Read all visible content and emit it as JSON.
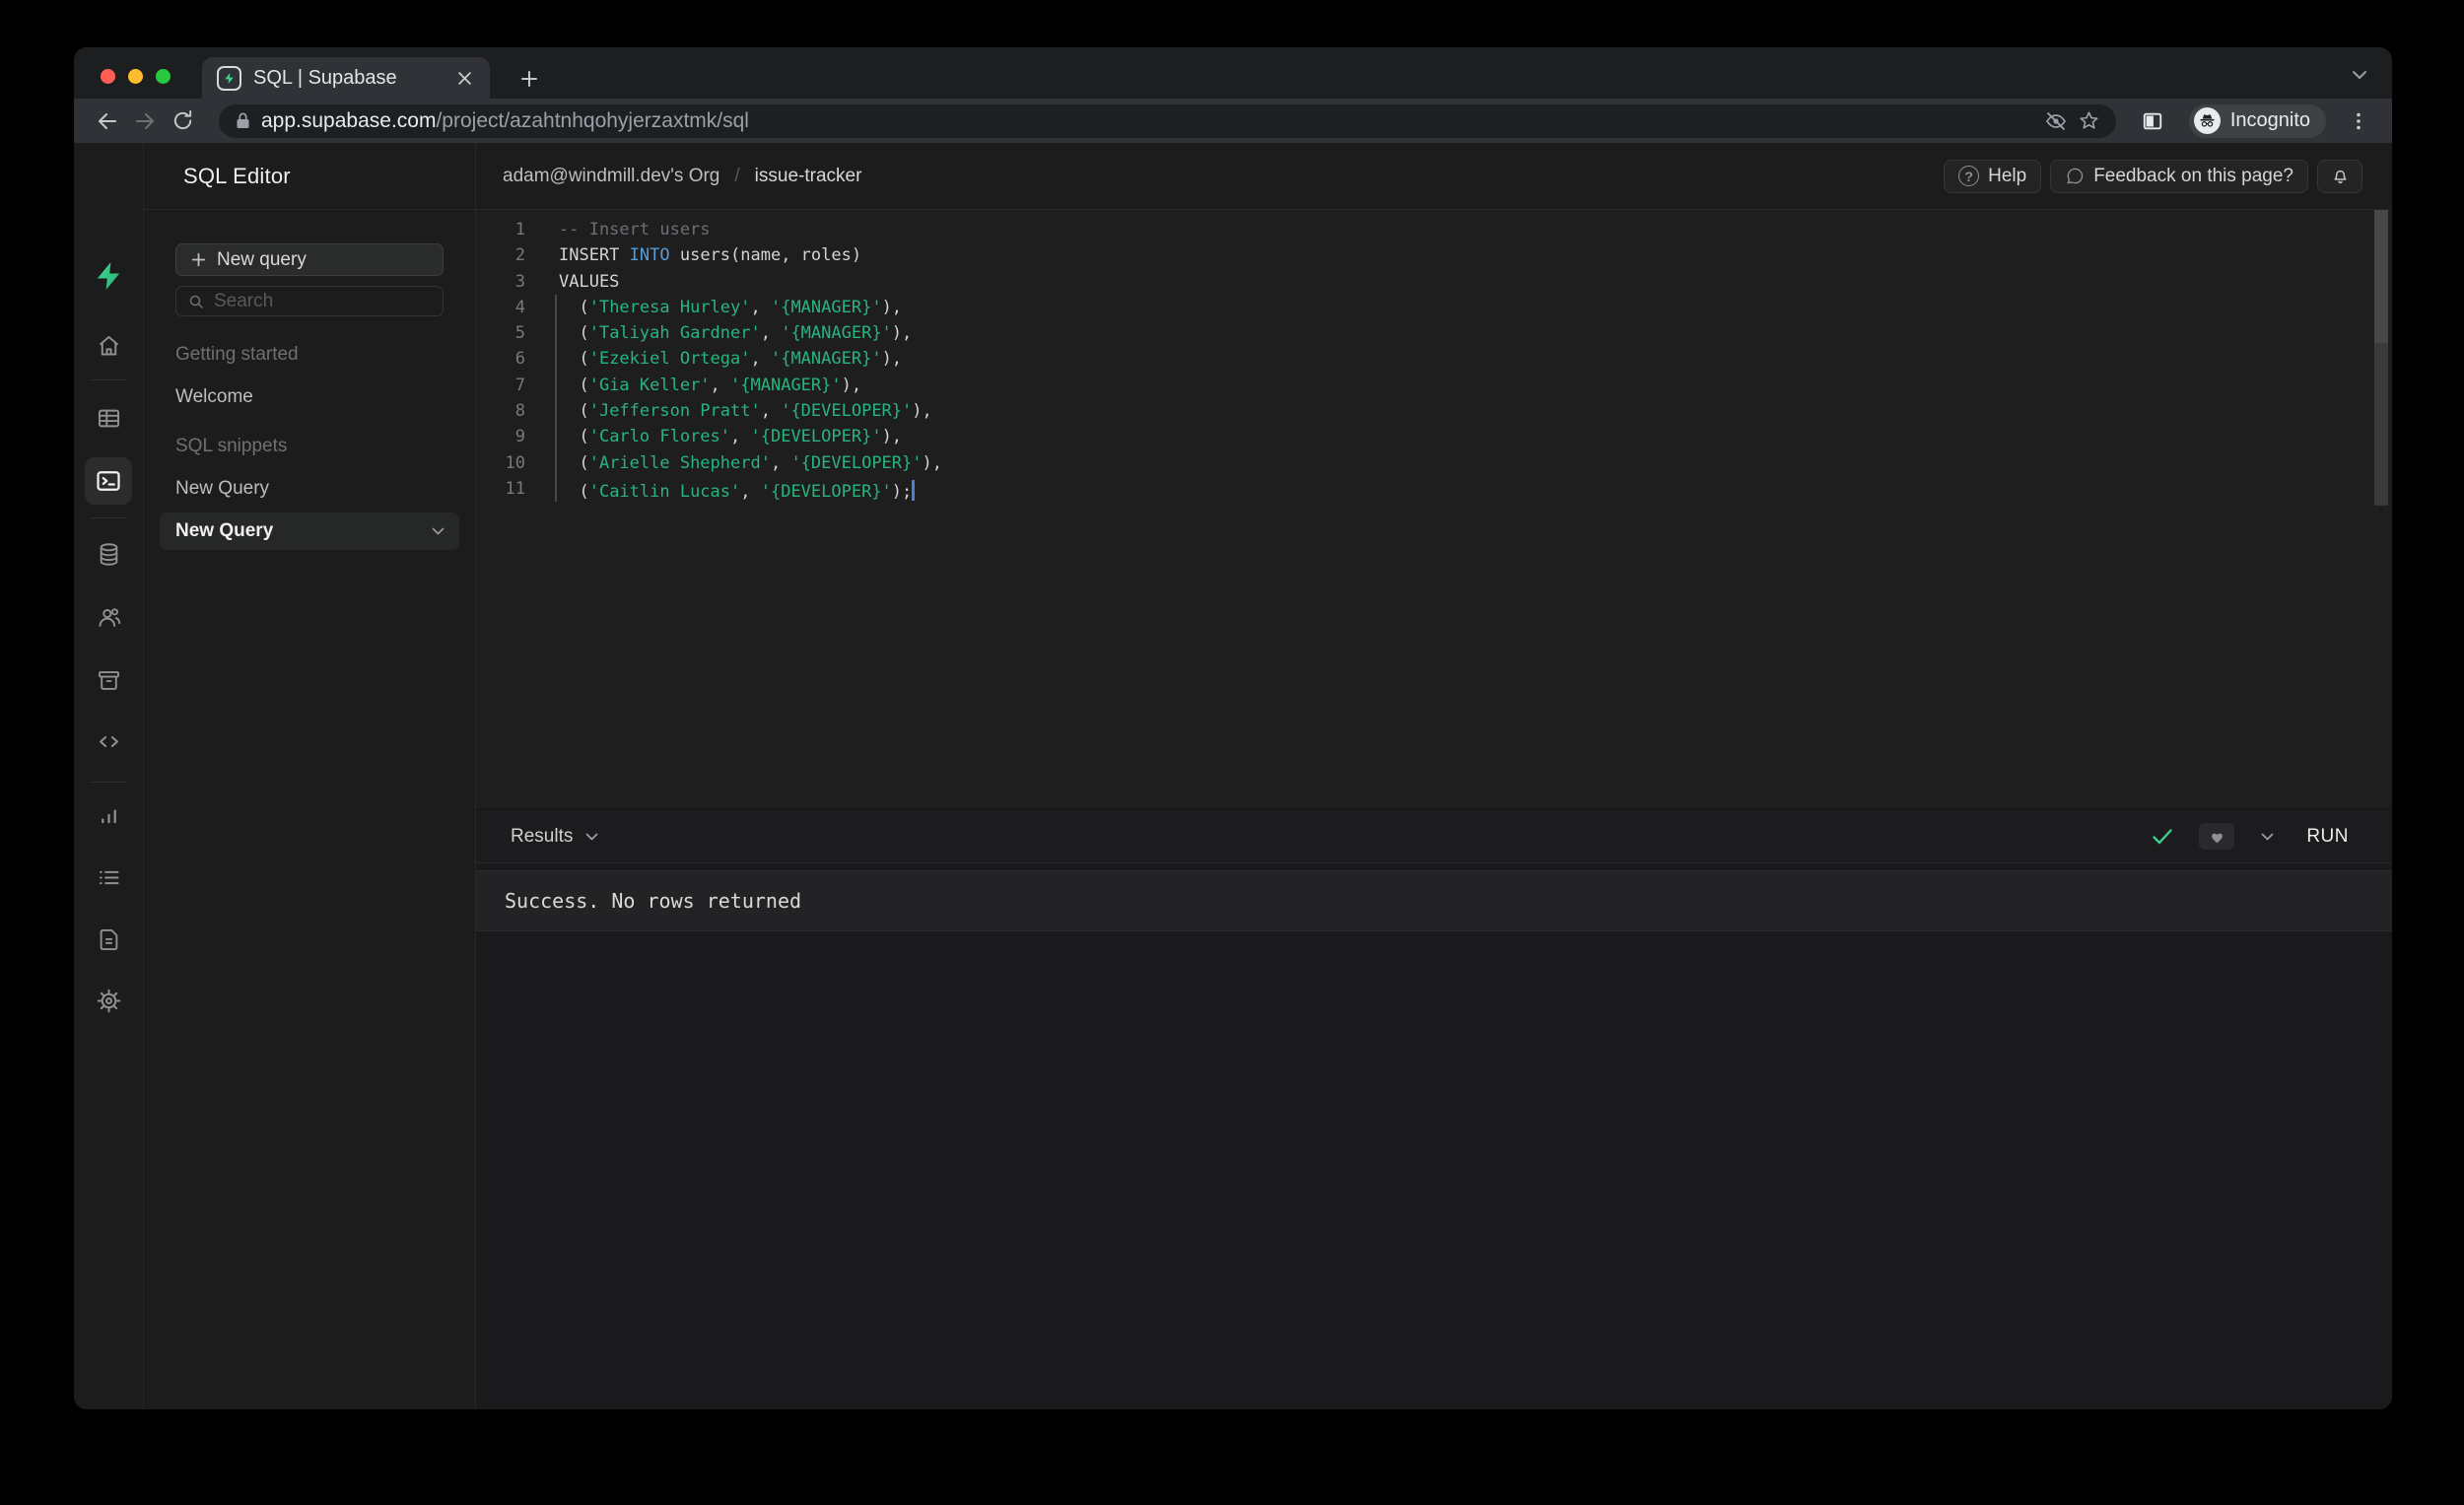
{
  "browser": {
    "tab_title": "SQL | Supabase",
    "url": {
      "host": "app.supabase.com",
      "path": "/project/azahtnhqohyjerzaxtmk/sql"
    },
    "incognito_label": "Incognito"
  },
  "sidebar": {
    "title": "SQL Editor",
    "new_query_button": "New query",
    "search_placeholder": "Search",
    "sections": [
      {
        "label": "Getting started",
        "items": [
          {
            "label": "Welcome",
            "selected": false
          }
        ]
      },
      {
        "label": "SQL snippets",
        "items": [
          {
            "label": "New Query",
            "selected": false
          },
          {
            "label": "New Query",
            "selected": true
          }
        ]
      }
    ]
  },
  "header": {
    "breadcrumb": {
      "org": "adam@windmill.dev's Org",
      "project": "issue-tracker"
    },
    "help_button": "Help",
    "feedback_button": "Feedback on this page?"
  },
  "editor": {
    "lines": [
      {
        "n": 1,
        "tokens": [
          {
            "c": "comment",
            "t": "-- Insert users"
          }
        ]
      },
      {
        "n": 2,
        "tokens": [
          {
            "c": "plain",
            "t": "INSERT "
          },
          {
            "c": "keyword",
            "t": "INTO"
          },
          {
            "c": "plain",
            "t": " users(name, roles)"
          }
        ]
      },
      {
        "n": 3,
        "tokens": [
          {
            "c": "plain",
            "t": "VALUES"
          }
        ]
      },
      {
        "n": 4,
        "tokens": [
          {
            "c": "plain",
            "t": "  ("
          },
          {
            "c": "string",
            "t": "'Theresa Hurley'"
          },
          {
            "c": "plain",
            "t": ", "
          },
          {
            "c": "string",
            "t": "'{MANAGER}'"
          },
          {
            "c": "plain",
            "t": "),"
          }
        ]
      },
      {
        "n": 5,
        "tokens": [
          {
            "c": "plain",
            "t": "  ("
          },
          {
            "c": "string",
            "t": "'Taliyah Gardner'"
          },
          {
            "c": "plain",
            "t": ", "
          },
          {
            "c": "string",
            "t": "'{MANAGER}'"
          },
          {
            "c": "plain",
            "t": "),"
          }
        ]
      },
      {
        "n": 6,
        "tokens": [
          {
            "c": "plain",
            "t": "  ("
          },
          {
            "c": "string",
            "t": "'Ezekiel Ortega'"
          },
          {
            "c": "plain",
            "t": ", "
          },
          {
            "c": "string",
            "t": "'{MANAGER}'"
          },
          {
            "c": "plain",
            "t": "),"
          }
        ]
      },
      {
        "n": 7,
        "tokens": [
          {
            "c": "plain",
            "t": "  ("
          },
          {
            "c": "string",
            "t": "'Gia Keller'"
          },
          {
            "c": "plain",
            "t": ", "
          },
          {
            "c": "string",
            "t": "'{MANAGER}'"
          },
          {
            "c": "plain",
            "t": "),"
          }
        ]
      },
      {
        "n": 8,
        "tokens": [
          {
            "c": "plain",
            "t": "  ("
          },
          {
            "c": "string",
            "t": "'Jefferson Pratt'"
          },
          {
            "c": "plain",
            "t": ", "
          },
          {
            "c": "string",
            "t": "'{DEVELOPER}'"
          },
          {
            "c": "plain",
            "t": "),"
          }
        ]
      },
      {
        "n": 9,
        "tokens": [
          {
            "c": "plain",
            "t": "  ("
          },
          {
            "c": "string",
            "t": "'Carlo Flores'"
          },
          {
            "c": "plain",
            "t": ", "
          },
          {
            "c": "string",
            "t": "'{DEVELOPER}'"
          },
          {
            "c": "plain",
            "t": "),"
          }
        ]
      },
      {
        "n": 10,
        "tokens": [
          {
            "c": "plain",
            "t": "  ("
          },
          {
            "c": "string",
            "t": "'Arielle Shepherd'"
          },
          {
            "c": "plain",
            "t": ", "
          },
          {
            "c": "string",
            "t": "'{DEVELOPER}'"
          },
          {
            "c": "plain",
            "t": "),"
          }
        ]
      },
      {
        "n": 11,
        "tokens": [
          {
            "c": "plain",
            "t": "  ("
          },
          {
            "c": "string",
            "t": "'Caitlin Lucas'"
          },
          {
            "c": "plain",
            "t": ", "
          },
          {
            "c": "string",
            "t": "'{DEVELOPER}'"
          },
          {
            "c": "plain",
            "t": ");"
          }
        ],
        "cursor": true
      }
    ]
  },
  "results": {
    "label": "Results",
    "run_button": "RUN",
    "message": "Success. No rows returned"
  },
  "colors": {
    "accent_green": "#3ecf8e",
    "string_green": "#27b57f",
    "keyword_blue": "#569cd6",
    "comment_gray": "#696f75"
  }
}
